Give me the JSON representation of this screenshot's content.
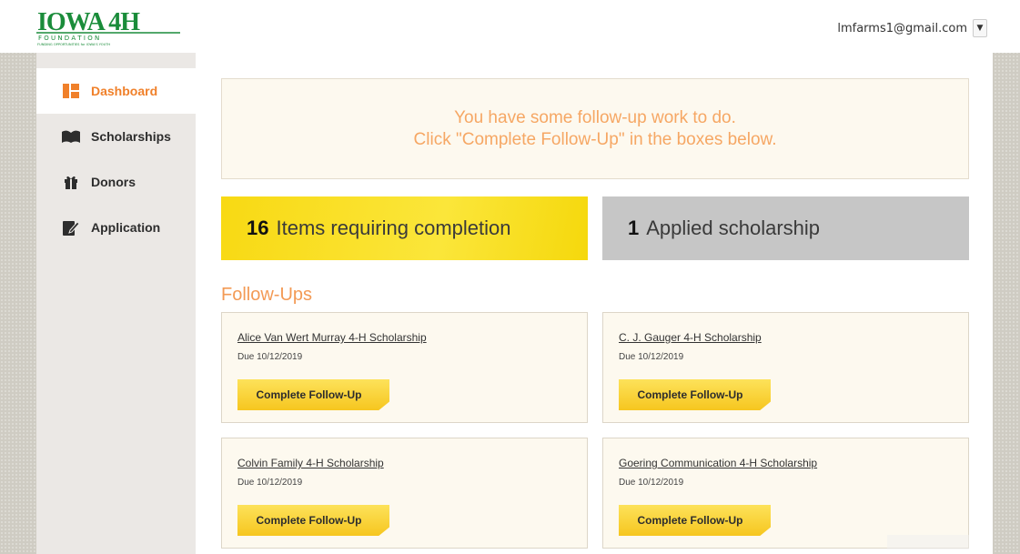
{
  "header": {
    "logo_main": "IOWA 4H",
    "logo_sub": "F O U N D A T I O N",
    "logo_tag": "FUNDING OPPORTUNITIES for IOWA'S YOUTH",
    "user_email": "lmfarms1@gmail.com",
    "user_caret": "▼"
  },
  "sidebar": {
    "items": [
      {
        "label": "Dashboard",
        "icon": "dashboard-icon",
        "active": true
      },
      {
        "label": "Scholarships",
        "icon": "open-book-icon",
        "active": false
      },
      {
        "label": "Donors",
        "icon": "gift-icon",
        "active": false
      },
      {
        "label": "Application",
        "icon": "edit-form-icon",
        "active": false
      }
    ]
  },
  "alert": {
    "line1": "You have some follow-up work to do.",
    "line2": "Click \"Complete Follow-Up\" in the boxes below."
  },
  "stats": {
    "items_count": "16",
    "items_label": "Items requiring completion",
    "applied_count": "1",
    "applied_label": "Applied scholarship"
  },
  "followups": {
    "title": "Follow-Ups",
    "button_label": "Complete Follow-Up",
    "cards": [
      {
        "title": "Alice Van Wert Murray 4-H Scholarship",
        "due": "Due 10/12/2019"
      },
      {
        "title": "C. J. Gauger 4-H Scholarship",
        "due": "Due 10/12/2019"
      },
      {
        "title": "Colvin Family 4-H Scholarship",
        "due": "Due 10/12/2019"
      },
      {
        "title": "Goering Communication 4-H Scholarship",
        "due": "Due 10/12/2019"
      }
    ]
  },
  "colors": {
    "accent": "#f0802a",
    "alert_text": "#f6a764",
    "stat_yellow": "#f8d913",
    "stat_gray": "#c6c6c6",
    "logo_green": "#1a8c3a"
  }
}
